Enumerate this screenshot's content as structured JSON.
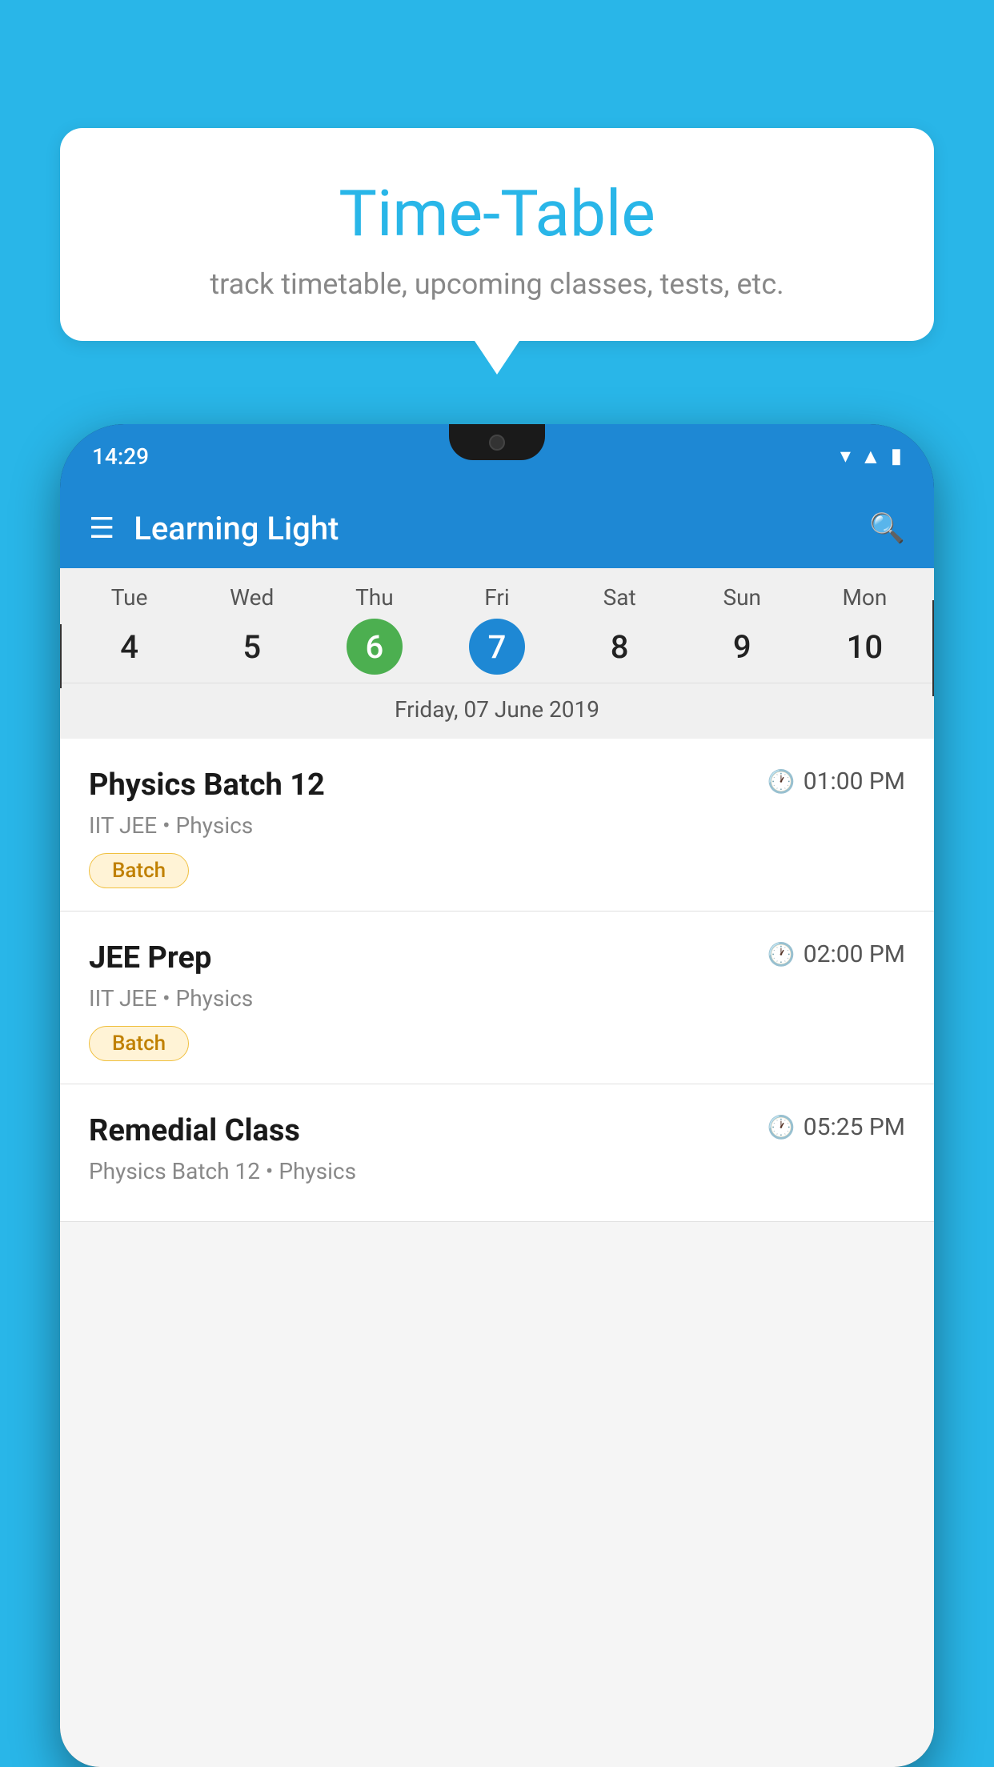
{
  "background_color": "#29b6e8",
  "tooltip": {
    "title": "Time-Table",
    "subtitle": "track timetable, upcoming classes, tests, etc."
  },
  "phone": {
    "status_bar": {
      "time": "14:29"
    },
    "app_bar": {
      "title": "Learning Light"
    },
    "calendar": {
      "days": [
        {
          "name": "Tue",
          "num": "4",
          "state": "normal"
        },
        {
          "name": "Wed",
          "num": "5",
          "state": "normal"
        },
        {
          "name": "Thu",
          "num": "6",
          "state": "today"
        },
        {
          "name": "Fri",
          "num": "7",
          "state": "selected"
        },
        {
          "name": "Sat",
          "num": "8",
          "state": "normal"
        },
        {
          "name": "Sun",
          "num": "9",
          "state": "normal"
        },
        {
          "name": "Mon",
          "num": "10",
          "state": "normal"
        }
      ],
      "selected_date_label": "Friday, 07 June 2019"
    },
    "events": [
      {
        "name": "Physics Batch 12",
        "time": "01:00 PM",
        "meta": "IIT JEE • Physics",
        "badge": "Batch"
      },
      {
        "name": "JEE Prep",
        "time": "02:00 PM",
        "meta": "IIT JEE • Physics",
        "badge": "Batch"
      },
      {
        "name": "Remedial Class",
        "time": "05:25 PM",
        "meta": "Physics Batch 12 • Physics",
        "badge": null
      }
    ]
  }
}
